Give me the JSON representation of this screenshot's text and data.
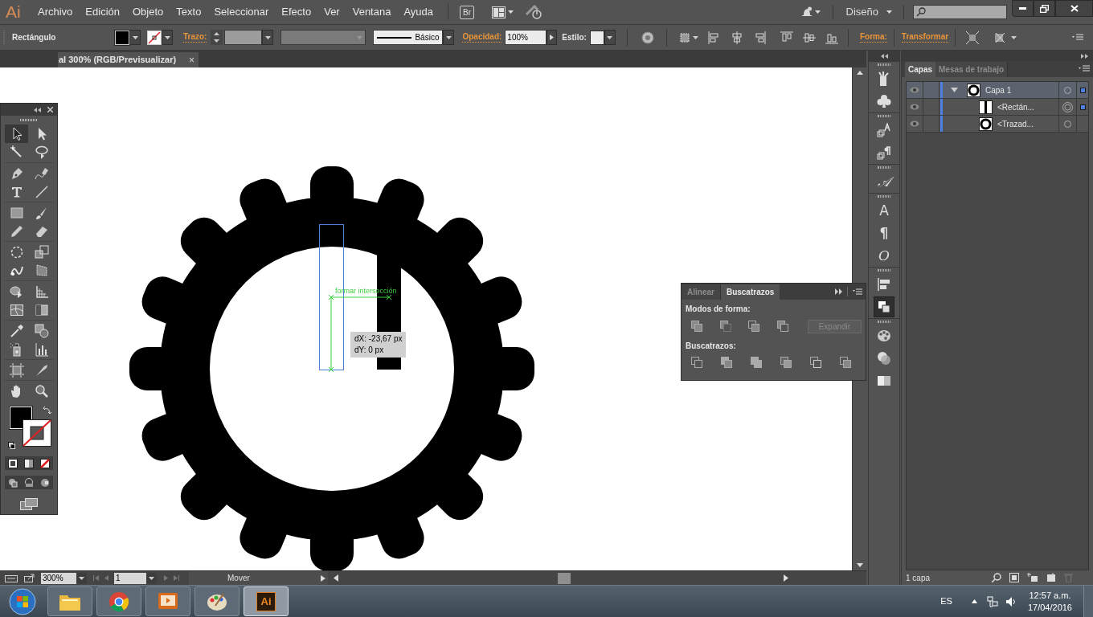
{
  "menu_bar": {
    "logo": "Ai",
    "items": [
      "Archivo",
      "Edición",
      "Objeto",
      "Texto",
      "Seleccionar",
      "Efecto",
      "Ver",
      "Ventana",
      "Ayuda"
    ],
    "bridge": "Br",
    "workspace": "Diseño"
  },
  "control_bar": {
    "selection_type": "Rectángulo",
    "stroke_label": "Trazo:",
    "stroke_profile": "Básico",
    "opacity_label": "Opacidad:",
    "opacity": "100%",
    "style_label": "Estilo:",
    "shape_label": "Forma:",
    "transform_label": "Transformar"
  },
  "tools": [
    {
      "kind": "selection",
      "selected": true
    },
    {
      "kind": "direct-selection",
      "selected": false
    },
    {
      "kind": "magic-wand",
      "selected": false
    },
    {
      "kind": "lasso",
      "selected": false
    },
    {
      "kind": "pen",
      "selected": false
    },
    {
      "kind": "curvature",
      "selected": false
    },
    {
      "kind": "type",
      "selected": false
    },
    {
      "kind": "line",
      "selected": false
    },
    {
      "kind": "rectangle",
      "selected": false
    },
    {
      "kind": "brush",
      "selected": false
    },
    {
      "kind": "pencil",
      "selected": false
    },
    {
      "kind": "eraser",
      "selected": false
    },
    {
      "kind": "rotate",
      "selected": false
    },
    {
      "kind": "scale",
      "selected": false
    },
    {
      "kind": "warp",
      "selected": false
    },
    {
      "kind": "free-transform",
      "selected": false
    },
    {
      "kind": "shape-builder",
      "selected": false
    },
    {
      "kind": "perspective",
      "selected": false
    },
    {
      "kind": "mesh",
      "selected": false
    },
    {
      "kind": "gradient",
      "selected": false
    },
    {
      "kind": "eyedropper",
      "selected": false
    },
    {
      "kind": "blend",
      "selected": false
    },
    {
      "kind": "sprayer",
      "selected": false
    },
    {
      "kind": "graph",
      "selected": false
    },
    {
      "kind": "artboard",
      "selected": false
    },
    {
      "kind": "slice",
      "selected": false
    },
    {
      "kind": "hand",
      "selected": false
    },
    {
      "kind": "zoom",
      "selected": false
    }
  ],
  "document_tab": {
    "title": "al 300% (RGB/Previsualizar)",
    "close": "×"
  },
  "canvas": {
    "smart_guide": "formar intersección",
    "tooltip": [
      "dX: -23,67 px",
      "dY: 0 px"
    ]
  },
  "pathfinder_panel": {
    "tabs": [
      {
        "label": "Alinear",
        "selected": false
      },
      {
        "label": "Buscatrazos",
        "selected": true
      }
    ],
    "shape_modes_label": "Modos de forma:",
    "expand_button": {
      "label": "Expandir",
      "disabled": true
    },
    "pathfinders_label": "Buscatrazos:"
  },
  "dock": [
    {
      "kind": "brushes",
      "selected": false
    },
    {
      "kind": "symbols",
      "selected": false
    },
    {
      "kind": "character-styles",
      "selected": false
    },
    {
      "kind": "paragraph-styles",
      "selected": false
    },
    {
      "kind": "glyph",
      "label": "𝒜",
      "selected": false
    },
    {
      "kind": "glyph",
      "label": "A",
      "selected": false
    },
    {
      "kind": "glyph",
      "label": "¶",
      "selected": false
    },
    {
      "kind": "glyph",
      "label": "O",
      "selected": false
    },
    {
      "kind": "align",
      "selected": false
    },
    {
      "kind": "pathfinder",
      "selected": true
    },
    {
      "kind": "color-guide",
      "selected": false
    },
    {
      "kind": "transparency",
      "selected": false
    },
    {
      "kind": "gradient",
      "selected": false
    }
  ],
  "layers_panel": {
    "tabs": [
      {
        "label": "Capas",
        "selected": true
      },
      {
        "label": "Mesas de trabajo",
        "selected": false
      }
    ],
    "layers": [
      {
        "name": "Capa 1",
        "visible": true,
        "expanded": true,
        "selected": true,
        "targeted": false,
        "has_selection": true,
        "kind": "gear",
        "children": [
          {
            "name": "<Rectán...",
            "visible": true,
            "selected": false,
            "targeted": true,
            "has_selection": true,
            "kind": "rectangle"
          },
          {
            "name": "<Trazad...",
            "visible": true,
            "selected": false,
            "targeted": false,
            "has_selection": false,
            "kind": "gear"
          }
        ]
      }
    ],
    "footer": "1 capa"
  },
  "status_bar": {
    "zoom": "300%",
    "artboard": "1",
    "tool": "Mover"
  },
  "taskbar": {
    "apps": [
      {
        "kind": "folder",
        "selected": false
      },
      {
        "kind": "browser",
        "selected": false
      },
      {
        "kind": "presentation",
        "selected": false
      },
      {
        "kind": "paint",
        "selected": false
      },
      {
        "kind": "illustrator",
        "label": "Ai",
        "selected": true
      }
    ],
    "language": "ES",
    "time": "12:57 a.m.",
    "date": "17/04/2016"
  }
}
